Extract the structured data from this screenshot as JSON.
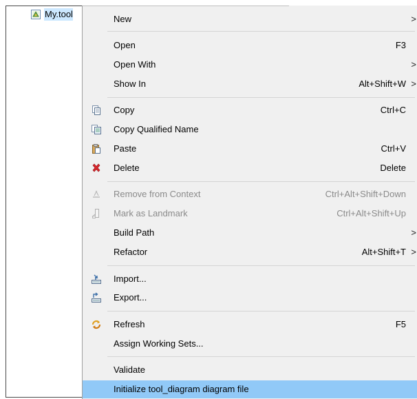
{
  "tree": {
    "file_label": "My.tool"
  },
  "menu": {
    "items": [
      {
        "label": "New",
        "shortcut": "",
        "submenu": true
      },
      {
        "label": "Open",
        "shortcut": "F3",
        "submenu": false
      },
      {
        "label": "Open With",
        "shortcut": "",
        "submenu": true
      },
      {
        "label": "Show In",
        "shortcut": "Alt+Shift+W",
        "submenu": true
      },
      {
        "label": "Copy",
        "shortcut": "Ctrl+C",
        "submenu": false
      },
      {
        "label": "Copy Qualified Name",
        "shortcut": "",
        "submenu": false
      },
      {
        "label": "Paste",
        "shortcut": "Ctrl+V",
        "submenu": false
      },
      {
        "label": "Delete",
        "shortcut": "Delete",
        "submenu": false
      },
      {
        "label": "Remove from Context",
        "shortcut": "Ctrl+Alt+Shift+Down",
        "submenu": false
      },
      {
        "label": "Mark as Landmark",
        "shortcut": "Ctrl+Alt+Shift+Up",
        "submenu": false
      },
      {
        "label": "Build Path",
        "shortcut": "",
        "submenu": true
      },
      {
        "label": "Refactor",
        "shortcut": "Alt+Shift+T",
        "submenu": true
      },
      {
        "label": "Import...",
        "shortcut": "",
        "submenu": false
      },
      {
        "label": "Export...",
        "shortcut": "",
        "submenu": false
      },
      {
        "label": "Refresh",
        "shortcut": "F5",
        "submenu": false
      },
      {
        "label": "Assign Working Sets...",
        "shortcut": "",
        "submenu": false
      },
      {
        "label": "Validate",
        "shortcut": "",
        "submenu": false
      },
      {
        "label": "Initialize tool_diagram diagram file",
        "shortcut": "",
        "submenu": false
      }
    ],
    "submenu_arrow": ">"
  },
  "icons": {
    "file": "diagram-file-icon",
    "copy": "copy-icon",
    "copy_qualified": "copy-qualified-name-icon",
    "paste": "paste-icon",
    "delete": "delete-icon",
    "remove_context": "remove-from-context-icon",
    "landmark": "mark-landmark-icon",
    "import": "import-icon",
    "export": "export-icon",
    "refresh": "refresh-icon"
  },
  "colors": {
    "menu_bg": "#f0f0f0",
    "highlight": "#91c9f7",
    "selection": "#cce8ff",
    "disabled_text": "#8a8a8a",
    "delete_red": "#d9262c"
  }
}
